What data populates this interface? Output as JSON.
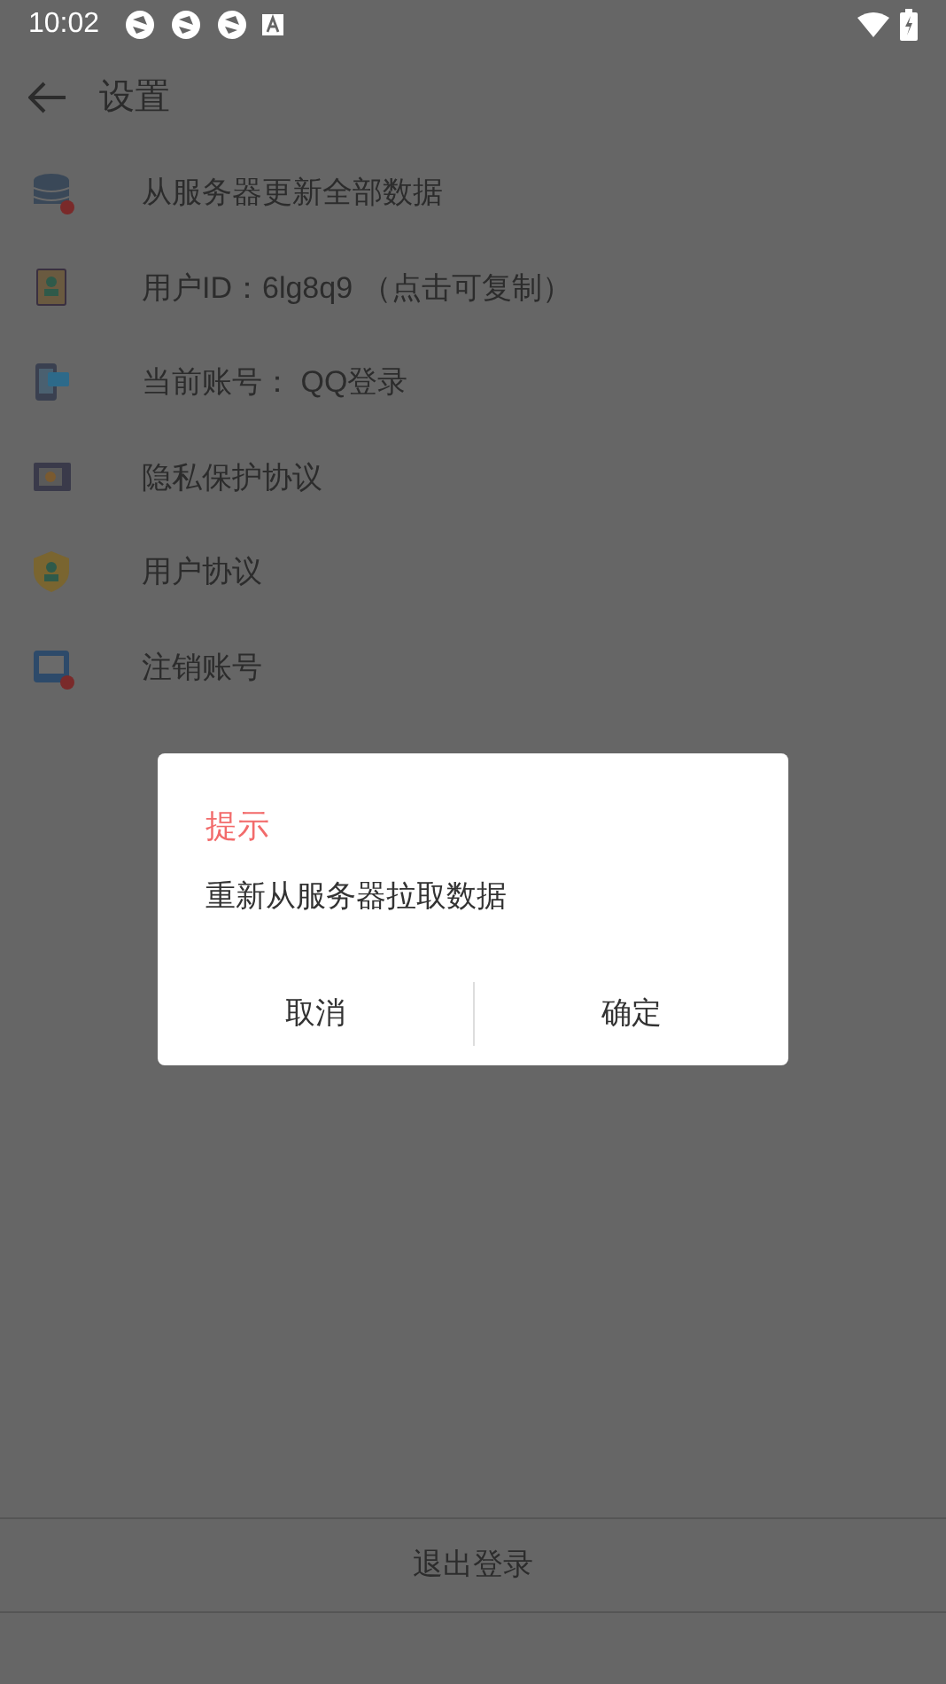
{
  "status_bar": {
    "time": "10:02"
  },
  "toolbar": {
    "title": "设置"
  },
  "items": [
    {
      "label": "从服务器更新全部数据"
    },
    {
      "label": "用户ID：6lg8q9 （点击可复制）"
    },
    {
      "label": "当前账号： QQ登录"
    },
    {
      "label": "隐私保护协议"
    },
    {
      "label": "用户协议"
    },
    {
      "label": "注销账号"
    }
  ],
  "dialog": {
    "title": "提示",
    "message": "重新从服务器拉取数据",
    "buttons": [
      "取消",
      "确定"
    ]
  },
  "logout_button": "退出登录"
}
